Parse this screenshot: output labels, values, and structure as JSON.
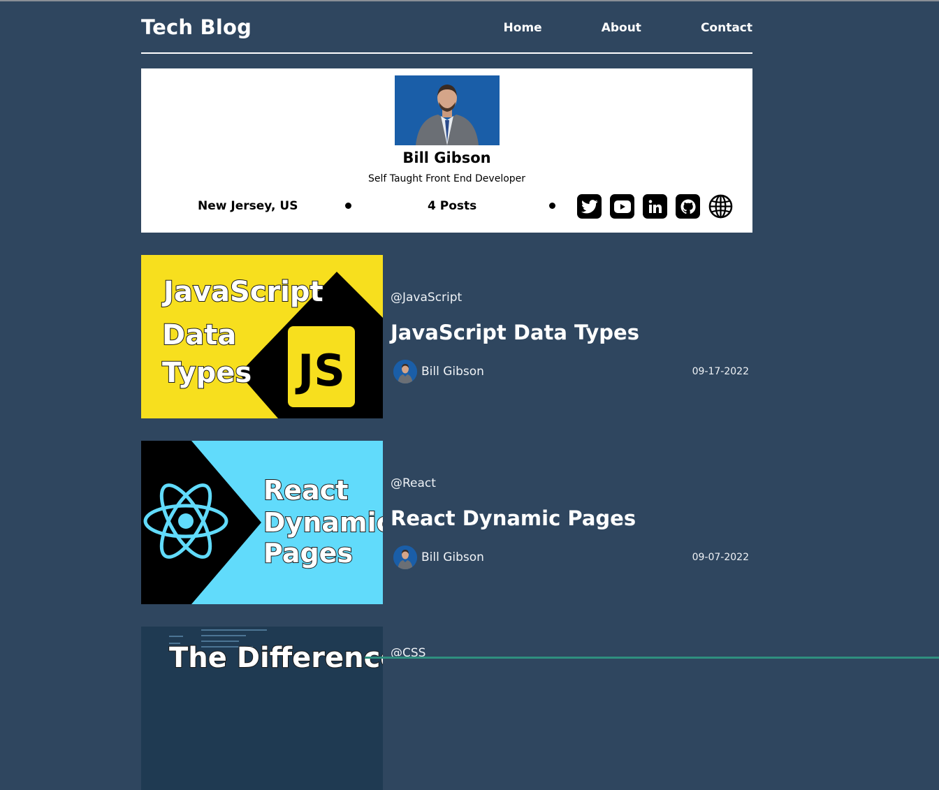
{
  "header": {
    "brand": "Tech Blog",
    "nav": [
      {
        "label": "Home"
      },
      {
        "label": "About"
      },
      {
        "label": "Contact"
      }
    ]
  },
  "profile": {
    "name": "Bill Gibson",
    "title": "Self Taught Front End Developer",
    "location": "New Jersey, US",
    "posts": "4 Posts",
    "socials": [
      "twitter-icon",
      "youtube-icon",
      "linkedin-icon",
      "github-icon",
      "globe-icon"
    ]
  },
  "posts": [
    {
      "tag": "@JavaScript",
      "title": "JavaScript Data Types",
      "author": "Bill Gibson",
      "date": "09-17-2022",
      "thumb_lines": [
        "JavaScript",
        "Data",
        "Types"
      ],
      "thumb_badge": "JS",
      "thumb_bg": "#f7df1e"
    },
    {
      "tag": "@React",
      "title": "React Dynamic Pages",
      "author": "Bill Gibson",
      "date": "09-07-2022",
      "thumb_lines": [
        "React",
        "Dynamic",
        "Pages"
      ],
      "thumb_bg": "#61dbfb"
    },
    {
      "tag": "@CSS",
      "title": "",
      "author": "",
      "date": "",
      "thumb_lines": [
        "The Difference"
      ]
    }
  ],
  "colors": {
    "page_bg": "#2f465f",
    "card_bg": "#ffffff",
    "js_yellow": "#f7df1e",
    "react_blue": "#61dbfb"
  }
}
